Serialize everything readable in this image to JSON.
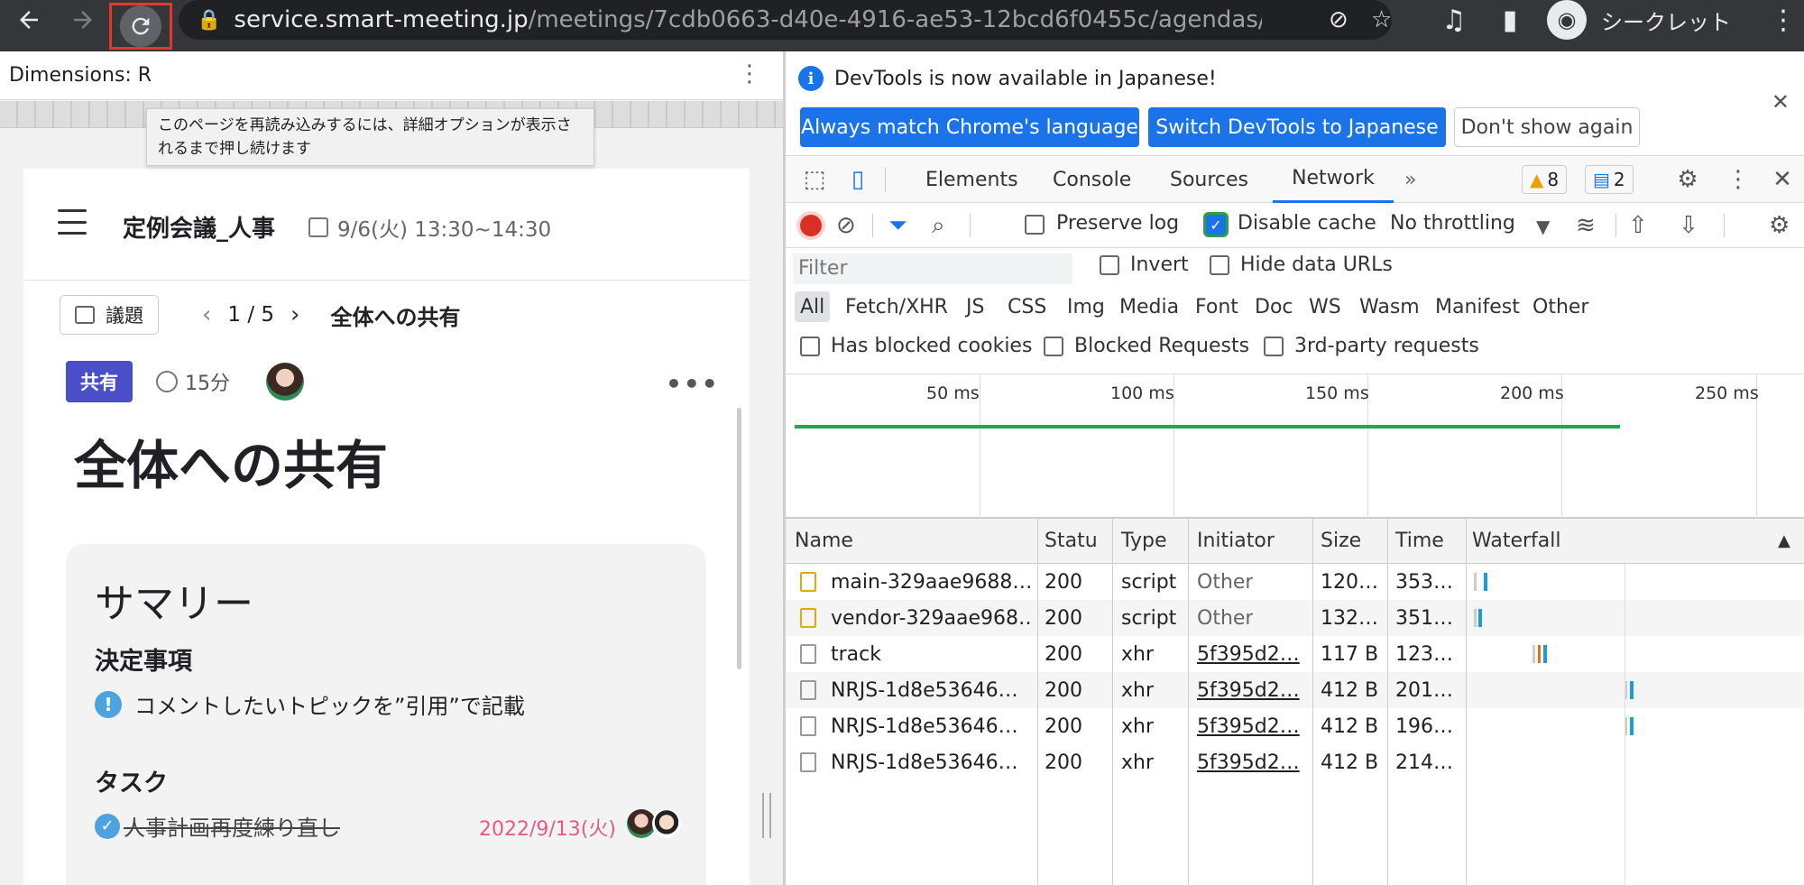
{
  "browser": {
    "url_host": "service.smart-meeting.jp",
    "url_path": "/meetings/7cdb0663-d40e-4916-ae53-12bcd6f0455c/agendas/...",
    "profile_label": "シークレット"
  },
  "left_panel": {
    "dimensions_label": "Dimensions: R",
    "tooltip": "このページを再読み込みするには、詳細オプションが表示されるまで押し続けます",
    "meeting_title": "定例会議_人事",
    "meeting_datetime": "9/6(火) 13:30~14:30",
    "agenda_button": "議題",
    "pager": "1 / 5",
    "agenda_title": "全体への共有",
    "tag": "共有",
    "duration": "15分",
    "big_title": "全体への共有",
    "summary": {
      "title": "サマリー",
      "decisions_heading": "決定事項",
      "decision_item": "コメントしたいトピックを”引用”で記載",
      "tasks_heading": "タスク",
      "task_item": "人事計画再度練り直し",
      "task_due": "2022/9/13(火)"
    }
  },
  "devtools": {
    "info_message": "DevTools is now available in Japanese!",
    "btn_match": "Always match Chrome's language",
    "btn_switch": "Switch DevTools to Japanese",
    "btn_dont": "Don't show again",
    "tabs": [
      "Elements",
      "Console",
      "Sources",
      "Network"
    ],
    "warnings_count": "8",
    "messages_count": "2",
    "preserve_log": "Preserve log",
    "disable_cache": "Disable cache",
    "throttling": "No throttling",
    "filter_placeholder": "Filter",
    "invert": "Invert",
    "hide_data_urls": "Hide data URLs",
    "types": [
      "All",
      "Fetch/XHR",
      "JS",
      "CSS",
      "Img",
      "Media",
      "Font",
      "Doc",
      "WS",
      "Wasm",
      "Manifest",
      "Other"
    ],
    "has_blocked_cookies": "Has blocked cookies",
    "blocked_requests": "Blocked Requests",
    "third_party": "3rd-party requests",
    "timeline_labels": [
      "50 ms",
      "100 ms",
      "150 ms",
      "200 ms",
      "250 ms"
    ],
    "columns": [
      "Name",
      "Status",
      "Type",
      "Initiator",
      "Size",
      "Time",
      "Waterfall"
    ],
    "rows": [
      {
        "name": "main-329aae9688…",
        "status": "200",
        "type": "script",
        "initiator": "Other",
        "size": "120…",
        "time": "353…"
      },
      {
        "name": "vendor-329aae968…",
        "status": "200",
        "type": "script",
        "initiator": "Other",
        "size": "132…",
        "time": "351…"
      },
      {
        "name": "track",
        "status": "200",
        "type": "xhr",
        "initiator": "5f395d2…",
        "size": "117 B",
        "time": "123…"
      },
      {
        "name": "NRJS-1d8e53646…",
        "status": "200",
        "type": "xhr",
        "initiator": "5f395d2…",
        "size": "412 B",
        "time": "201…"
      },
      {
        "name": "NRJS-1d8e53646…",
        "status": "200",
        "type": "xhr",
        "initiator": "5f395d2…",
        "size": "412 B",
        "time": "196…"
      },
      {
        "name": "NRJS-1d8e53646…",
        "status": "200",
        "type": "xhr",
        "initiator": "5f395d2…",
        "size": "412 B",
        "time": "214…"
      }
    ]
  }
}
